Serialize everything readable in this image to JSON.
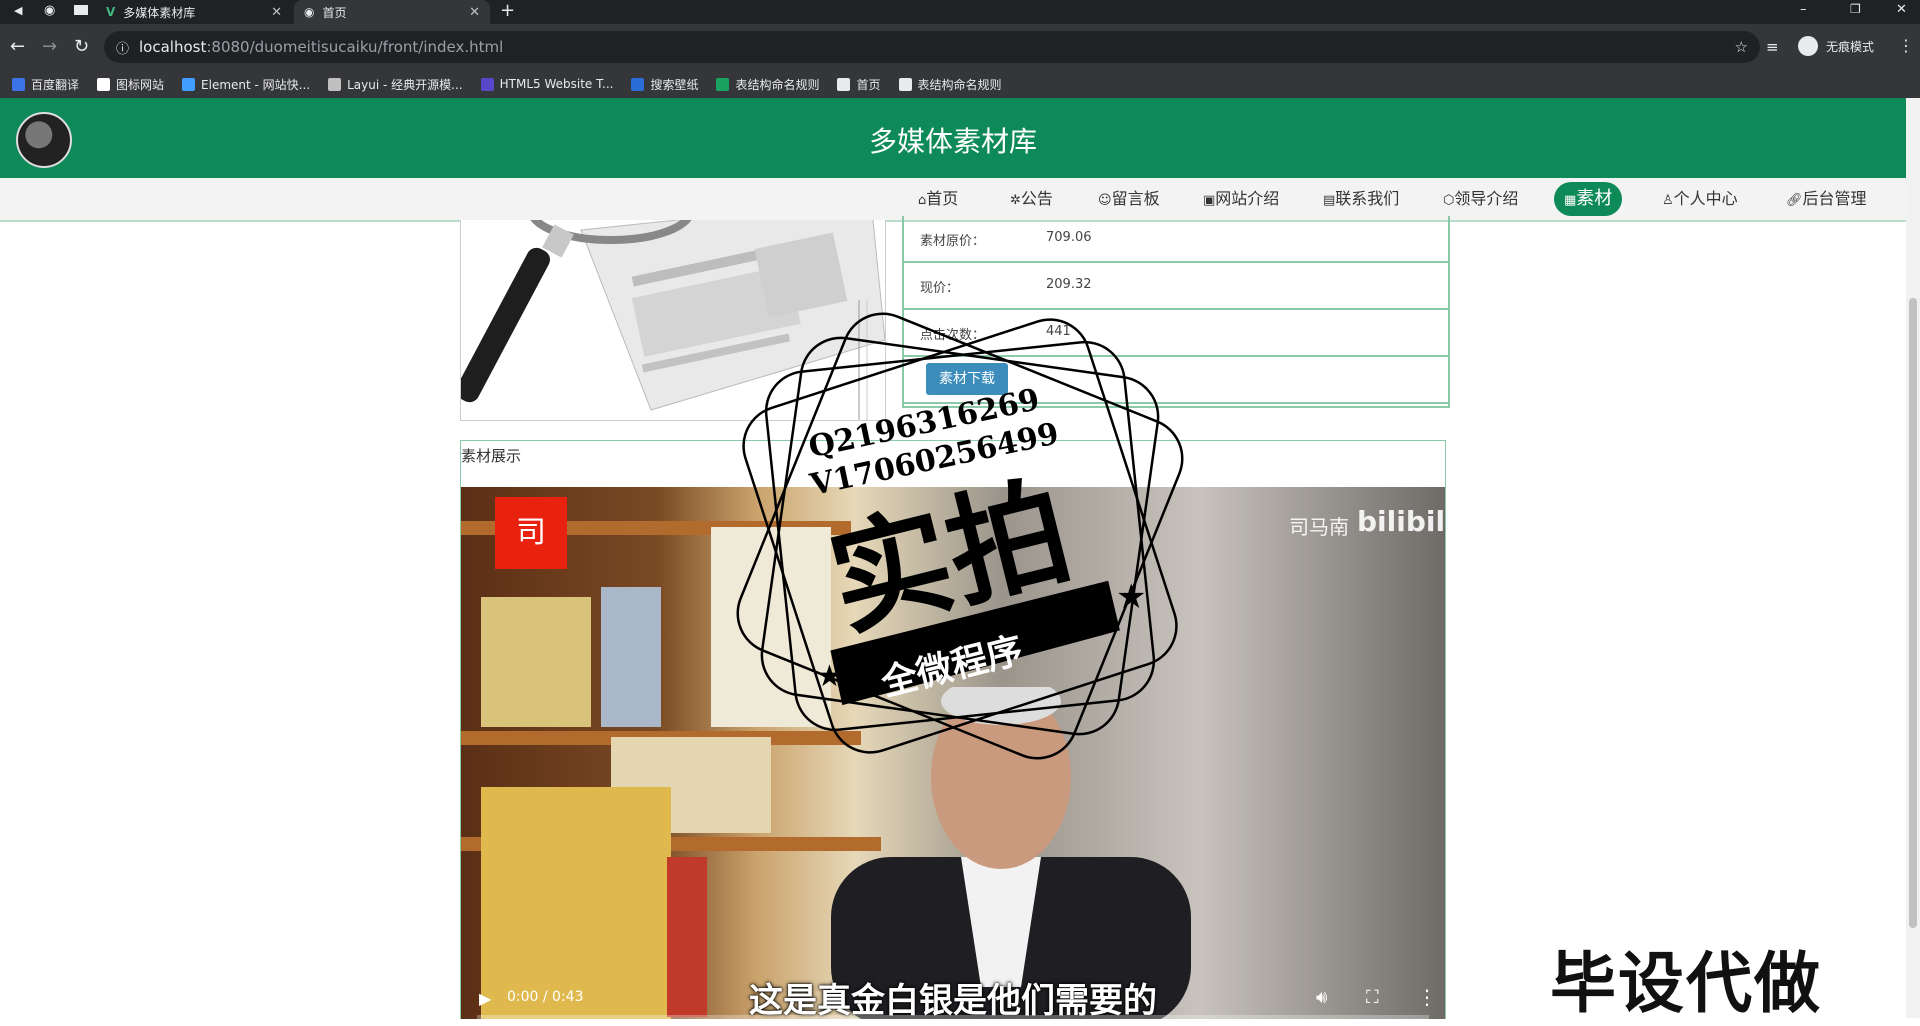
{
  "browser": {
    "tabs": [
      {
        "title": "多媒体素材库",
        "active": false
      },
      {
        "title": "首页",
        "active": true
      }
    ],
    "new_tab": "+",
    "url_host": "localhost",
    "url_rest": ":8080/duomeitisucaiku/front/index.html",
    "profile_label": "无痕模式",
    "window_controls": [
      "–",
      "❐",
      "✕"
    ],
    "bookmarks": [
      {
        "label": "百度翻译",
        "icon": "translate-icon",
        "color": "#3b73e8"
      },
      {
        "label": "图标网站",
        "icon": "flag-icon",
        "color": "#ffffff"
      },
      {
        "label": "Element - 网站快...",
        "icon": "element-icon",
        "color": "#409eff"
      },
      {
        "label": "Layui - 经典开源模...",
        "icon": "layui-icon",
        "color": "#c0c0c0"
      },
      {
        "label": "HTML5 Website T...",
        "icon": "html5-icon",
        "color": "#5a46c9"
      },
      {
        "label": "搜索壁纸",
        "icon": "wallpaper-icon",
        "color": "#2b6dd6"
      },
      {
        "label": "表结构命名规则",
        "icon": "sheet-icon",
        "color": "#1aa260"
      },
      {
        "label": "首页",
        "icon": "globe-icon",
        "color": "#e8eaed"
      },
      {
        "label": "表结构命名规则",
        "icon": "globe-icon",
        "color": "#e8eaed"
      }
    ]
  },
  "site": {
    "title": "多媒体素材库",
    "brand_color": "#0e8a58",
    "nav": [
      {
        "label": "首页",
        "icon": "home-icon",
        "active": false
      },
      {
        "label": "公告",
        "icon": "notice-icon",
        "active": false
      },
      {
        "label": "留言板",
        "icon": "message-icon",
        "active": false
      },
      {
        "label": "网站介绍",
        "icon": "info-icon",
        "active": false
      },
      {
        "label": "联系我们",
        "icon": "contact-icon",
        "active": false
      },
      {
        "label": "领导介绍",
        "icon": "leader-icon",
        "active": false
      },
      {
        "label": "素材",
        "icon": "material-icon",
        "active": true
      },
      {
        "label": "个人中心",
        "icon": "user-icon",
        "active": false
      },
      {
        "label": "后台管理",
        "icon": "link-icon",
        "active": false
      }
    ]
  },
  "detail": {
    "rows": [
      {
        "label": "素材原价：",
        "value": "709.06"
      },
      {
        "label": "现价：",
        "value": "209.32"
      },
      {
        "label": "点击次数：",
        "value": "441"
      }
    ],
    "download_label": "素材下载"
  },
  "showcase": {
    "title": "素材展示",
    "channel_badge": "司",
    "channel_name": "司马南",
    "platform": "bilibili",
    "subtitle": "这是真金白银是他们需要的",
    "time": "0:00 / 0:43",
    "progress": 0
  },
  "watermark": {
    "contact_q": "Q2196316269",
    "contact_v": "V17060256499",
    "big_text": "实拍",
    "banner": "全微程序"
  },
  "bottom_mark": "毕设代做"
}
